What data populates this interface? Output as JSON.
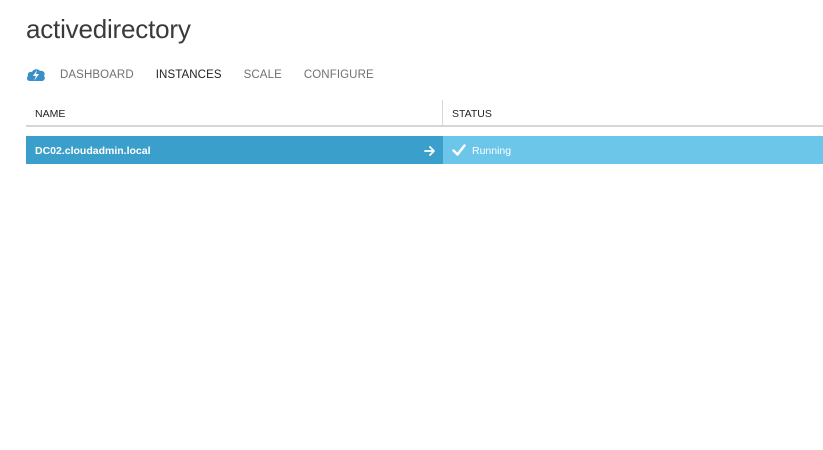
{
  "page": {
    "title": "activedirectory"
  },
  "nav": {
    "icon": "cloud-service-icon",
    "tabs": [
      {
        "label": "DASHBOARD",
        "active": false
      },
      {
        "label": "INSTANCES",
        "active": true
      },
      {
        "label": "SCALE",
        "active": false
      },
      {
        "label": "CONFIGURE",
        "active": false
      }
    ]
  },
  "table": {
    "columns": [
      "NAME",
      "STATUS"
    ],
    "rows": [
      {
        "name": "DC02.cloudadmin.local",
        "status": "Running",
        "status_icon": "check-icon",
        "action_icon": "arrow-right-icon",
        "selected": true
      }
    ]
  },
  "colors": {
    "selected_row": "#3b9fcb",
    "status_cell": "#6cc6ea",
    "icon_blue": "#3b8fc8"
  }
}
